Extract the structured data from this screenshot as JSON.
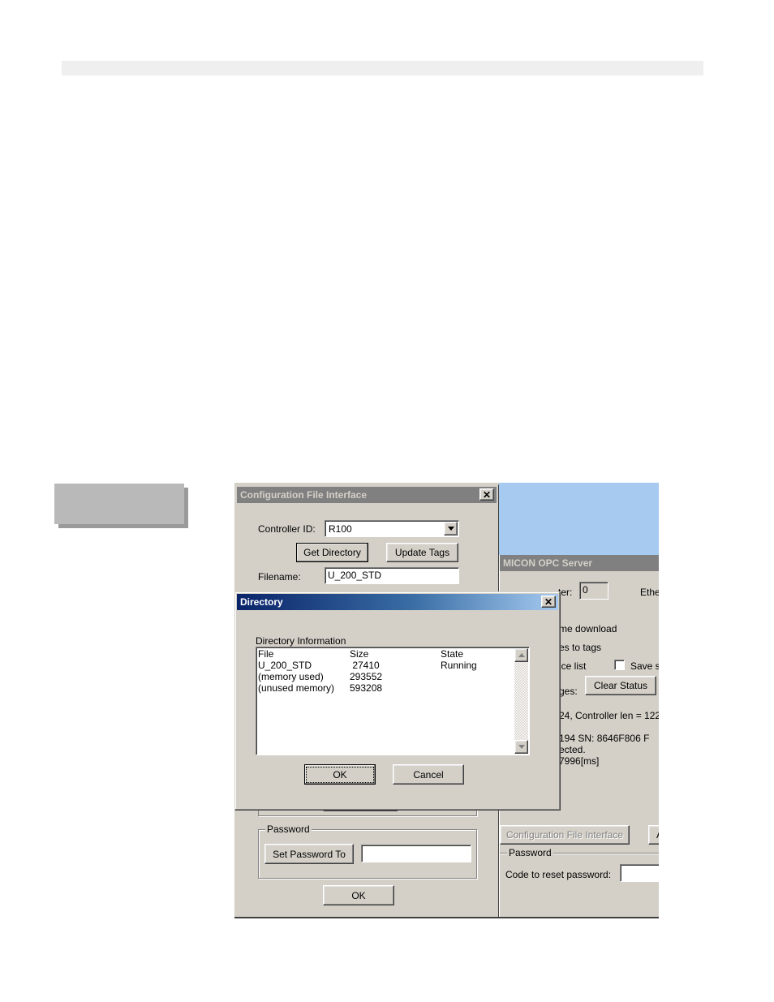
{
  "config_window": {
    "title": "Configuration File Interface",
    "controller_id_label": "Controller ID:",
    "controller_id_value": "R100",
    "get_directory_label": "Get Directory",
    "update_tags_label": "Update Tags",
    "filename_label": "Filename:",
    "filename_value": "U_200_STD",
    "password_group_label": "Password",
    "set_password_label": "Set Password To",
    "ok_label": "OK"
  },
  "opc_window": {
    "title": "MICON OPC Server",
    "adapter_label": "ter:",
    "adapter_value": "0",
    "ethe_label": "Ethe",
    "line_download": "me download",
    "line_tags": "es to tags",
    "line_device_list": "ice list",
    "save_label": "Save s",
    "messages_label": "ges:",
    "clear_status_label": "Clear Status",
    "status_line1": "24, Controller len = 122",
    "status_line2": "194  SN: 8646F806  F",
    "status_line3": "ected.",
    "status_line4": "7996[ms]",
    "config_file_button_label": "Configuration File Interface",
    "a_button_label": "A",
    "password_label": "Password",
    "reset_code_label": "Code to reset password:"
  },
  "directory_dialog": {
    "title": "Directory",
    "info_label": "Directory Information",
    "headers": [
      "File",
      "Size",
      "State"
    ],
    "rows": [
      [
        "U_200_STD",
        " 27410",
        "Running"
      ],
      [
        "(memory used)",
        "293552",
        ""
      ],
      [
        "(unused memory)",
        "593208",
        ""
      ]
    ],
    "ok_label": "OK",
    "cancel_label": "Cancel"
  },
  "colors": {
    "desktop_blue": "#a6caf0",
    "face": "#d4d0c8",
    "title_active_start": "#0a246a",
    "title_active_end": "#a6caf0",
    "title_inactive": "#808080"
  }
}
